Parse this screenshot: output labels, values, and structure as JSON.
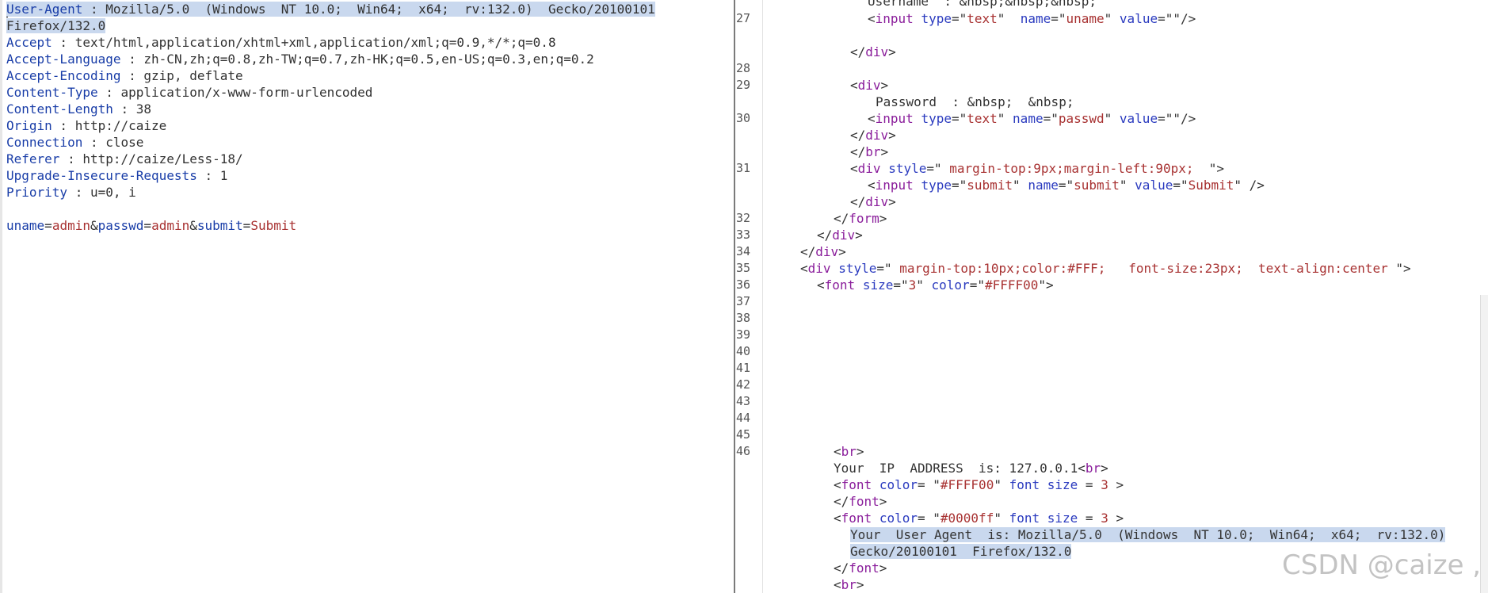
{
  "request": {
    "headers": [
      {
        "key": "User-Agent",
        "sep": " : ",
        "value": "Mozilla/5.0  (Windows  NT 10.0;  Win64;  x64;  rv:132.0)  Gecko/20100101"
      },
      {
        "key": "",
        "sep": "",
        "value": "Firefox/132.0"
      },
      {
        "key": "Accept",
        "sep": " : ",
        "value": "text/html,application/xhtml+xml,application/xml;q=0.9,*/*;q=0.8"
      },
      {
        "key": "Accept-Language",
        "sep": " : ",
        "value": "zh-CN,zh;q=0.8,zh-TW;q=0.7,zh-HK;q=0.5,en-US;q=0.3,en;q=0.2"
      },
      {
        "key": "Accept-Encoding",
        "sep": " : ",
        "value": "gzip, deflate"
      },
      {
        "key": "Content-Type",
        "sep": " : ",
        "value": "application/x-www-form-urlencoded"
      },
      {
        "key": "Content-Length",
        "sep": " : ",
        "value": "38"
      },
      {
        "key": "Origin",
        "sep": " : ",
        "value": "http://caize"
      },
      {
        "key": "Connection",
        "sep": " : ",
        "value": "close"
      },
      {
        "key": "Referer",
        "sep": " : ",
        "value": "http://caize/Less-18/"
      },
      {
        "key": "Upgrade-Insecure-Requests",
        "sep": " : ",
        "value": "1"
      },
      {
        "key": "Priority",
        "sep": " : ",
        "value": "u=0, i"
      }
    ],
    "body": {
      "k1": "uname",
      "v1": "admin",
      "k2": "passwd",
      "v2": "admin",
      "k3": "submit",
      "v3": "Submit"
    }
  },
  "response": {
    "line_numbers": [
      "27",
      "28",
      "29",
      "30",
      "31",
      "32",
      "33",
      "34",
      "35",
      "36",
      "37",
      "38",
      "39",
      "40",
      "41",
      "42",
      "43",
      "44",
      "45",
      "46"
    ],
    "username_text": "Username  : &nbsp;&nbsp;&nbsp;",
    "password_text": "Password  : &nbsp;  &nbsp;",
    "uname_input": {
      "tag": "input",
      "type_attr": "type",
      "type_val": "text",
      "name_attr": "name",
      "name_val": "uname",
      "value_attr": "value",
      "value_val": ""
    },
    "passwd_input": {
      "tag": "input",
      "type_attr": "type",
      "type_val": "text",
      "name_attr": "name",
      "name_val": "passwd",
      "value_attr": "value",
      "value_val": ""
    },
    "submit_div_style": "margin-top:9px;margin-left:90px;  ",
    "submit_input": {
      "tag": "input",
      "type_attr": "type",
      "type_val": "submit",
      "name_attr": "name",
      "name_val": "submit",
      "value_attr": "value",
      "value_val": "Submit"
    },
    "div_tag": "div",
    "form_tag": "form",
    "br_tag": "br",
    "font_tag": "font",
    "style_attr": "style",
    "color_attr": "color",
    "size_attr": "size",
    "outer_div_style": "margin-top:10px;color:#FFF;   font-size:23px;  text-align:center ",
    "font_size_val": "3",
    "font_color_val": "#FFFF00",
    "ip_text": "Your  IP  ADDRESS  is: 127.0.0.1",
    "font2_color_val": "#0000ff",
    "font_size_word": "font size",
    "font_size_num": "3",
    "ua_line1": "Your  User Agent  is: Mozilla/5.0  (Windows  NT 10.0;  Win64;  x64;  rv:132.0)",
    "ua_line2": "Gecko/20100101  Firefox/132.0"
  },
  "watermark": "CSDN @caize ,"
}
